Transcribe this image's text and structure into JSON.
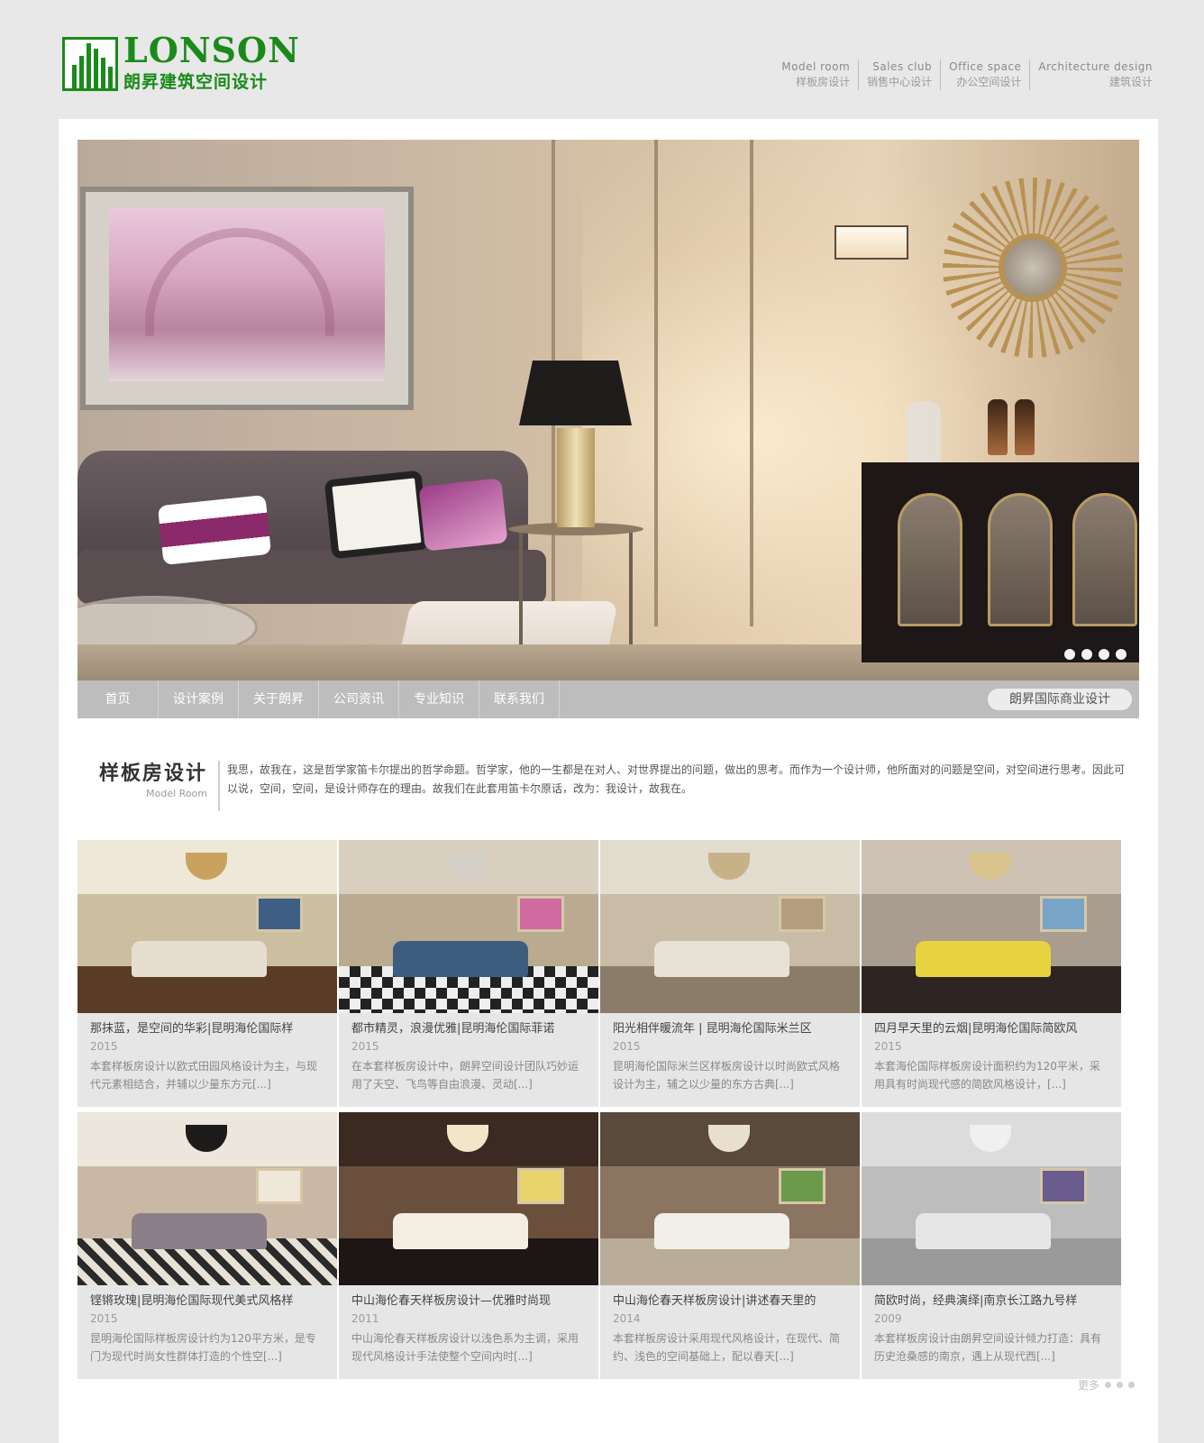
{
  "logo": {
    "en": "LONSON",
    "cn": "朗昇建筑空间设计"
  },
  "topnav": [
    {
      "en": "Model room",
      "cn": "样板房设计"
    },
    {
      "en": "Sales club",
      "cn": "销售中心设计"
    },
    {
      "en": "Office space",
      "cn": "办公空间设计"
    },
    {
      "en": "Architecture design",
      "cn": "建筑设计"
    }
  ],
  "banner": {
    "slide_count": 4,
    "active_slide": 1
  },
  "nav": {
    "items": [
      "首页",
      "设计案例",
      "关于朗昇",
      "公司资讯",
      "专业知识",
      "联系我们"
    ],
    "pill": "朗昇国际商业设计"
  },
  "section": {
    "title_cn": "样板房设计",
    "title_en": "Model Room",
    "description": "我思，故我在，这是哲学家笛卡尔提出的哲学命题。哲学家，他的一生都是在对人、对世界提出的问题，做出的思考。而作为一个设计师，他所面对的问题是空间，对空间进行思考。因此可以说，空间，空间，是设计师存在的理由。故我们在此套用笛卡尔原话，改为：我设计，故我在。"
  },
  "cards": [
    {
      "title": "那抹蓝，是空间的华彩|昆明海伦国际样",
      "year": "2015",
      "desc": "本套样板房设计以欧式田园风格设计为主，与现代元素相结合，并辅以少量东方元[...]"
    },
    {
      "title": "都市精灵，浪漫优雅|昆明海伦国际菲诺",
      "year": "2015",
      "desc": "在本套样板房设计中，朗昇空间设计团队巧妙运用了天空、飞鸟等自由浪漫、灵动[...]"
    },
    {
      "title": "阳光相伴暖流年 | 昆明海伦国际米兰区",
      "year": "2015",
      "desc": "昆明海伦国际米兰区样板房设计以时尚欧式风格设计为主，辅之以少量的东方古典[...]"
    },
    {
      "title": "四月早天里的云烟|昆明海伦国际简欧风",
      "year": "2015",
      "desc": "本套海伦国际样板房设计面积约为120平米，采用具有时尚现代感的简欧风格设计，[...]"
    },
    {
      "title": "铿锵玫瑰|昆明海伦国际现代美式风格样",
      "year": "2015",
      "desc": "昆明海伦国际样板房设计约为120平方米，是专门为现代时尚女性群体打造的个性空[...]"
    },
    {
      "title": "中山海伦春天样板房设计—优雅时尚现",
      "year": "2011",
      "desc": "中山海伦春天样板房设计以浅色系为主调，采用现代风格设计手法使整个空间内时[...]"
    },
    {
      "title": "中山海伦春天样板房设计|讲述春天里的",
      "year": "2014",
      "desc": "本套样板房设计采用现代风格设计，在现代、简约、浅色的空间基础上，配以春天[...]"
    },
    {
      "title": "简欧时尚，经典演绎|南京长江路九号样",
      "year": "2009",
      "desc": "本套样板房设计由朗昇空间设计倾力打造：具有历史沧桑感的南京，遇上从现代西[...]"
    }
  ],
  "more_label": "更多",
  "colors": {
    "brand": "#1a8a1a",
    "navbar": "#bdbdbd",
    "page_bg": "#e8e8e8",
    "card_bg": "#e6e6e6"
  }
}
